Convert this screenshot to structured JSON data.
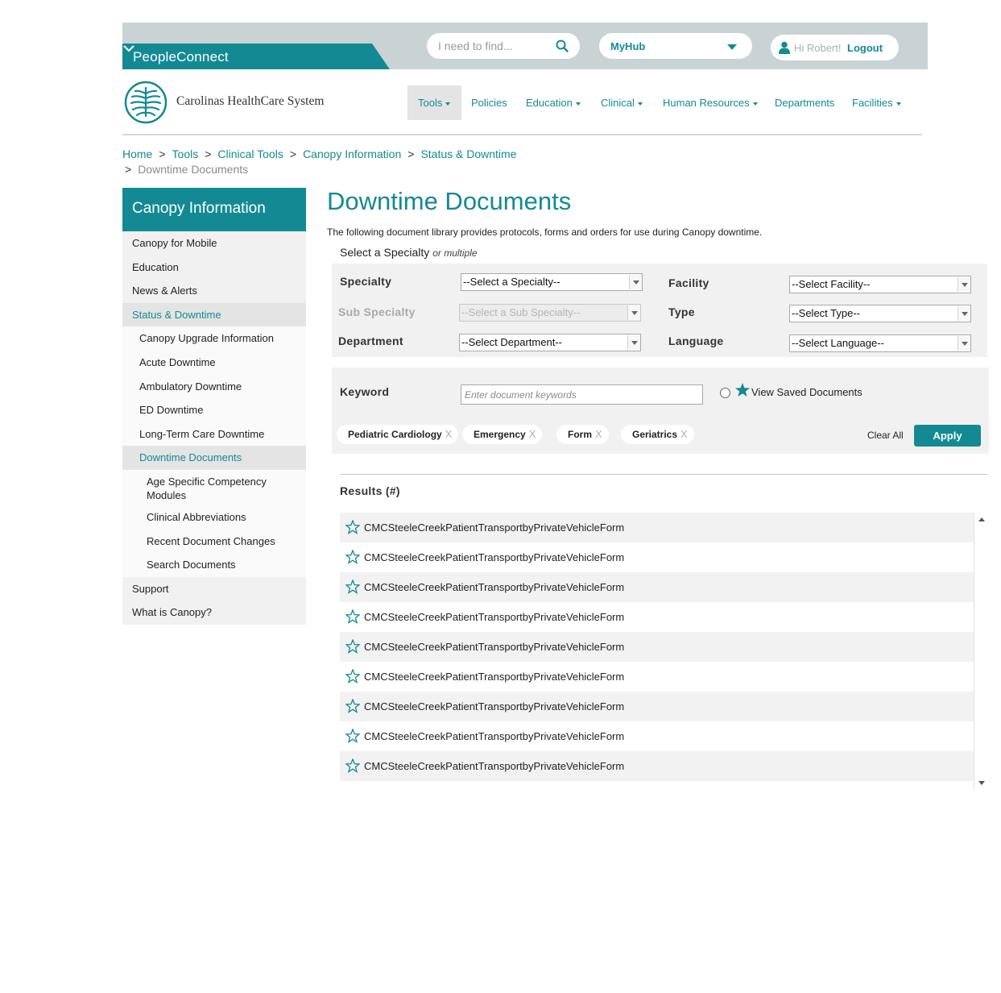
{
  "header": {
    "app_name": "PeopleConnect",
    "search_placeholder": "I need to find...",
    "hub_label": "MyHub",
    "greeting": "Hi Robert!",
    "logout_label": "Logout"
  },
  "brand": {
    "name": "Carolinas HealthCare System",
    "accent_color": "#138a93"
  },
  "nav": {
    "items": [
      {
        "label": "Tools",
        "dropdown": true,
        "active": true
      },
      {
        "label": "Policies",
        "dropdown": false
      },
      {
        "label": "Education",
        "dropdown": true
      },
      {
        "label": "Clinical",
        "dropdown": true
      },
      {
        "label": "Human Resources",
        "dropdown": true
      },
      {
        "label": "Departments",
        "dropdown": false
      },
      {
        "label": "Facilities",
        "dropdown": true
      }
    ]
  },
  "breadcrumb": {
    "items": [
      "Home",
      "Tools",
      "Clinical Tools",
      "Canopy Information",
      "Status & Downtime"
    ],
    "current": "Downtime Documents",
    "separator": ">"
  },
  "sidebar": {
    "title": "Canopy Information",
    "items": [
      {
        "label": "Canopy for Mobile",
        "level": 1
      },
      {
        "label": "Education",
        "level": 1
      },
      {
        "label": "News & Alerts",
        "level": 1
      },
      {
        "label": "Status & Downtime",
        "level": 1,
        "active": true
      },
      {
        "label": "Canopy Upgrade Information",
        "level": 2
      },
      {
        "label": "Acute Downtime",
        "level": 2
      },
      {
        "label": "Ambulatory Downtime",
        "level": 2
      },
      {
        "label": "ED Downtime",
        "level": 2
      },
      {
        "label": "Long-Term Care Downtime",
        "level": 2
      },
      {
        "label": "Downtime Documents",
        "level": 2,
        "active": true
      },
      {
        "label": "Age Specific Competency Modules",
        "level": 3
      },
      {
        "label": "Clinical Abbreviations",
        "level": 3
      },
      {
        "label": "Recent Document Changes",
        "level": 3
      },
      {
        "label": "Search Documents",
        "level": 3
      },
      {
        "label": "Support",
        "level": 1
      },
      {
        "label": "What is Canopy?",
        "level": 1
      }
    ]
  },
  "main": {
    "title": "Downtime Documents",
    "intro": "The following document library provides protocols, forms and orders for use during Canopy downtime.",
    "specialty_prompt": "Select a Specialty",
    "specialty_prompt_suffix": "or multiple",
    "filters": {
      "specialty": {
        "label": "Specialty",
        "value": "--Select a Specialty--"
      },
      "sub_specialty": {
        "label": "Sub Specialty",
        "value": "--Select a Sub Specialty--",
        "disabled": true
      },
      "department": {
        "label": "Department",
        "value": "--Select Department--"
      },
      "facility": {
        "label": "Facility",
        "value": "--Select Facility--"
      },
      "type": {
        "label": "Type",
        "value": "--Select Type--"
      },
      "language": {
        "label": "Language",
        "value": "--Select Language--"
      }
    },
    "keyword": {
      "label": "Keyword",
      "placeholder": "Enter document keywords",
      "saved_label": "View Saved Documents"
    },
    "chips": [
      "Pediatric Cardiology",
      "Emergency",
      "Form",
      "Geriatrics"
    ],
    "chip_remove": "X",
    "clear_all_label": "Clear All",
    "apply_label": "Apply",
    "results_title": "Results (#)",
    "results": [
      "CMCSteeleCreekPatientTransportbyPrivateVehicleForm",
      "CMCSteeleCreekPatientTransportbyPrivateVehicleForm",
      "CMCSteeleCreekPatientTransportbyPrivateVehicleForm",
      "CMCSteeleCreekPatientTransportbyPrivateVehicleForm",
      "CMCSteeleCreekPatientTransportbyPrivateVehicleForm",
      "CMCSteeleCreekPatientTransportbyPrivateVehicleForm",
      "CMCSteeleCreekPatientTransportbyPrivateVehicleForm",
      "CMCSteeleCreekPatientTransportbyPrivateVehicleForm",
      "CMCSteeleCreekPatientTransportbyPrivateVehicleForm"
    ]
  }
}
